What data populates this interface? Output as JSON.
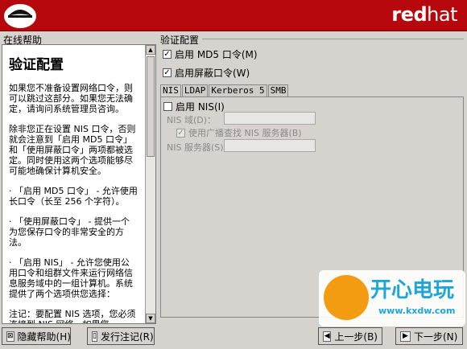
{
  "banner": {
    "brand_red": "red",
    "brand_hat": "hat",
    "bg_color": "#b6070c"
  },
  "help": {
    "section_label": "在线帮助",
    "heading": "验证配置",
    "paragraphs": [
      "如果您不准备设置网络口令，则可以跳过这部分。如果您无法确定，请询问系统管理员咨询。",
      "除非您正在设置 NIS 口令，否则就会注意到「启用 MD5 口令」和「使用屏蔽口令」两项都被选定。同时使用这两个选项能够尽可能地确保计算机安全。",
      "· 「启用 MD5 口令」 - 允许使用长口令（长至 256 个字符）。",
      "· 「使用屏蔽口令」 - 提供一个为您保存口令的非常安全的方法。",
      "· 「启用 NIS」 - 允许您使用公用口令和组群文件来运行网络信息服务域中的一组计算机。系统提供了两个选项供您选择：",
      "注记：要配置 NIS 选项，您必须连接到 NIS 网络。如果您"
    ]
  },
  "auth": {
    "label": "验证配置",
    "md5": {
      "label": "启用 MD5 口令(M)",
      "checked": true
    },
    "shadow": {
      "label": "启用屏蔽口令(W)",
      "checked": true
    }
  },
  "tabs": [
    "NIS",
    "LDAP",
    "Kerberos 5",
    "SMB"
  ],
  "nis": {
    "enable_label": "启用 NIS(I)",
    "domain_label": "NIS 域(D)：",
    "domain_value": "",
    "broadcast_label": "使用广播查找 NIS 服务器(B)",
    "server_label": "NIS 服务器(S)",
    "server_value": ""
  },
  "buttons": {
    "hide_help": "隐藏帮助(H)",
    "release_notes": "发行注记(R)",
    "back": "上一步(B)",
    "next": "下一步(N)"
  },
  "watermark": {
    "title": "开心电玩",
    "url": "www.kxdw.com"
  }
}
